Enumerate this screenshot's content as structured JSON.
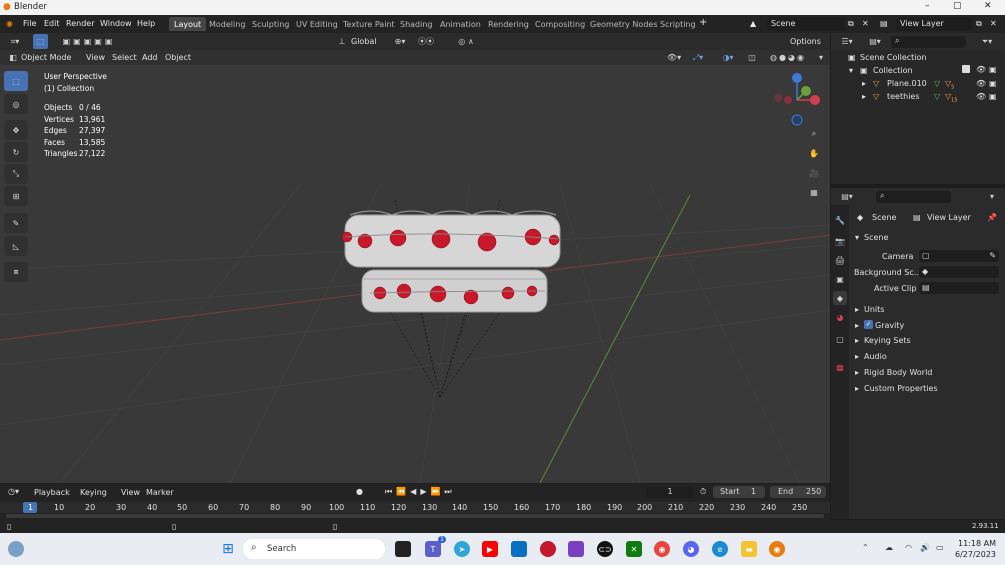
{
  "window": {
    "title": "Blender"
  },
  "menu": {
    "items": [
      "File",
      "Edit",
      "Render",
      "Window",
      "Help"
    ]
  },
  "workspaces": [
    "Layout",
    "Modeling",
    "Sculpting",
    "UV Editing",
    "Texture Paint",
    "Shading",
    "Animation",
    "Rendering",
    "Compositing",
    "Geometry Nodes",
    "Scripting"
  ],
  "scene_field": "Scene",
  "view_layer_field": "View Layer",
  "header": {
    "transform": "Global",
    "options": "Options"
  },
  "viewport_header": {
    "mode": "Object Mode",
    "menus": [
      "View",
      "Select",
      "Add",
      "Object"
    ]
  },
  "overlay": {
    "perspective": "User Perspective",
    "collection": "(1) Collection",
    "stats": [
      {
        "label": "Objects",
        "value": "0 / 46"
      },
      {
        "label": "Vertices",
        "value": "13,961"
      },
      {
        "label": "Edges",
        "value": "27,397"
      },
      {
        "label": "Faces",
        "value": "13,585"
      },
      {
        "label": "Triangles",
        "value": "27,122"
      }
    ]
  },
  "outliner": {
    "root": "Scene Collection",
    "collection": "Collection",
    "objects": [
      {
        "name": "Plane.010",
        "badge": "5"
      },
      {
        "name": "teethies",
        "badge": "15"
      }
    ]
  },
  "properties": {
    "tabs": {
      "scene": "Scene",
      "view_layer": "View Layer"
    },
    "panel_title": "Scene",
    "fields": [
      {
        "label": "Camera"
      },
      {
        "label": "Background Sc..."
      },
      {
        "label": "Active Clip"
      }
    ],
    "sections": [
      "Units",
      "Gravity",
      "Keying Sets",
      "Audio",
      "Rigid Body World",
      "Custom Properties"
    ],
    "gravity_checked": true
  },
  "timeline": {
    "menus": [
      "Playback",
      "Keying",
      "View",
      "Marker"
    ],
    "current_frame": "1",
    "start_label": "Start",
    "start": "1",
    "end_label": "End",
    "end": "250",
    "ruler": [
      "1",
      "10",
      "20",
      "30",
      "40",
      "50",
      "60",
      "70",
      "80",
      "90",
      "100",
      "110",
      "120",
      "130",
      "140",
      "150",
      "160",
      "170",
      "180",
      "190",
      "200",
      "210",
      "220",
      "230",
      "240",
      "250"
    ]
  },
  "status": {
    "version": "2.93.11"
  },
  "taskbar": {
    "search": "Search",
    "time": "11:18 AM",
    "date": "6/27/2023",
    "notification": "1"
  },
  "colors": {
    "accent": "#4772b3",
    "heart": "#c8182a",
    "viewport": "#393939"
  }
}
